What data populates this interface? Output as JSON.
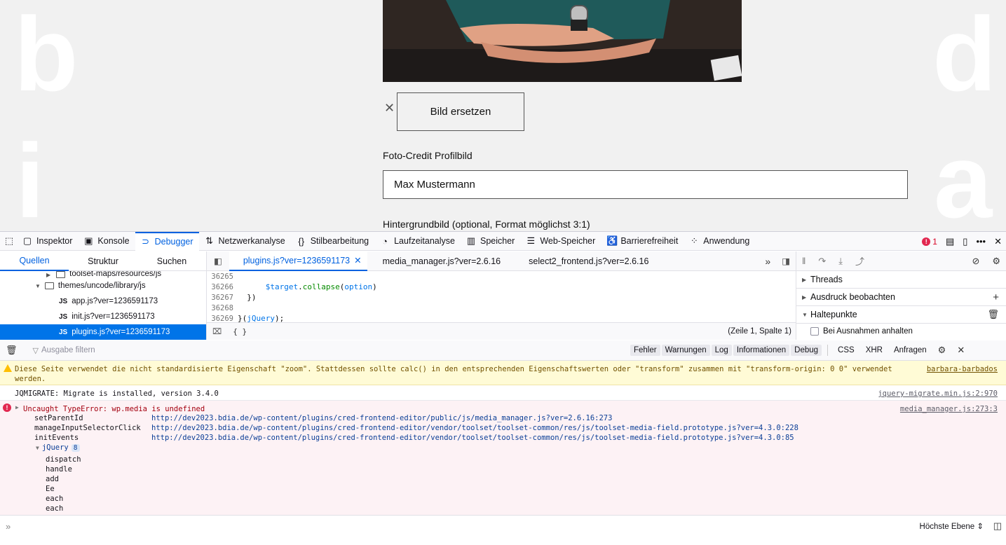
{
  "page": {
    "letters": [
      "b",
      "i",
      "d",
      "a"
    ],
    "replace_button": "Bild ersetzen",
    "remove_label": "✕",
    "credit_label": "Foto-Credit Profilbild",
    "credit_value": "Max Mustermann",
    "background_label": "Hintergrundbild (optional, Format möglichst 3:1)"
  },
  "devtools": {
    "tabs": [
      "Inspektor",
      "Konsole",
      "Debugger",
      "Netzwerkanalyse",
      "Stilbearbeitung",
      "Laufzeitanalyse",
      "Speicher",
      "Web-Speicher",
      "Barrierefreiheit",
      "Anwendung"
    ],
    "active_tab": "Debugger",
    "error_count": "1",
    "source_tabs": [
      "Quellen",
      "Struktur",
      "Suchen"
    ],
    "tree": {
      "partial": "toolset-maps/resources/js",
      "folder": "themes/uncode/library/js",
      "files": [
        "app.js?ver=1236591173",
        "init.js?ver=1236591173",
        "plugins.js?ver=1236591173"
      ],
      "js_tag": "JS"
    },
    "editor_tabs": [
      "plugins.js?ver=1236591173",
      "media_manager.js?ver=2.6.16",
      "select2_frontend.js?ver=2.6.16"
    ],
    "code_lines": [
      {
        "num": "36265",
        "code": ""
      },
      {
        "num": "36266",
        "var": "$target",
        "dot": ".",
        "fn": "collapse",
        "open": "(",
        "arg": "option",
        "close": ")"
      },
      {
        "num": "36267",
        "code": "  })"
      },
      {
        "num": "36268",
        "code": ""
      },
      {
        "num": "36269",
        "code": "}(",
        "arg": "jQuery",
        "tail": ");"
      }
    ],
    "editor_footer": {
      "braces": "{ }",
      "position": "(Zeile 1, Spalte 1)"
    },
    "side_sections": [
      "Threads",
      "Ausdruck beobachten",
      "Haltepunkte"
    ],
    "pause_exceptions": "Bei Ausnahmen anhalten",
    "console": {
      "filter_placeholder": "Ausgabe filtern",
      "filters": [
        "Fehler",
        "Warnungen",
        "Log",
        "Informationen",
        "Debug"
      ],
      "net_filters": [
        "CSS",
        "XHR",
        "Anfragen"
      ],
      "warning": {
        "text": "Diese Seite verwendet die nicht standardisierte Eigenschaft \"zoom\". Stattdessen sollte calc() in den entsprechenden Eigenschaftswerten oder \"transform\" zusammen mit \"transform-origin: 0 0\" verwendet werden.",
        "source": "barbara-barbados"
      },
      "log": {
        "text": "JQMIGRATE: Migrate is installed, version 3.4.0",
        "source": "jquery-migrate.min.js:2:970"
      },
      "error": {
        "text": "Uncaught TypeError: wp.media is undefined",
        "source": "media_manager.js:273:3",
        "stack": [
          {
            "fn": "setParentId",
            "url": "http://dev2023.bdia.de/wp-content/plugins/cred-frontend-editor/public/js/media_manager.js?ver=2.6.16:273"
          },
          {
            "fn": "manageInputSelectorClick",
            "url": "http://dev2023.bdia.de/wp-content/plugins/cred-frontend-editor/vendor/toolset/toolset-common/res/js/toolset-media-field.prototype.js?ver=4.3.0:228"
          },
          {
            "fn": "initEvents",
            "url": "http://dev2023.bdia.de/wp-content/plugins/cred-frontend-editor/vendor/toolset/toolset-common/res/js/toolset-media-field.prototype.js?ver=4.3.0:85"
          }
        ],
        "jquery_label": "jQuery",
        "jquery_count": "8",
        "jquery_frames": [
          "dispatch",
          "handle",
          "add",
          "Ee",
          "each",
          "each"
        ]
      },
      "context": "Höchste Ebene"
    }
  }
}
